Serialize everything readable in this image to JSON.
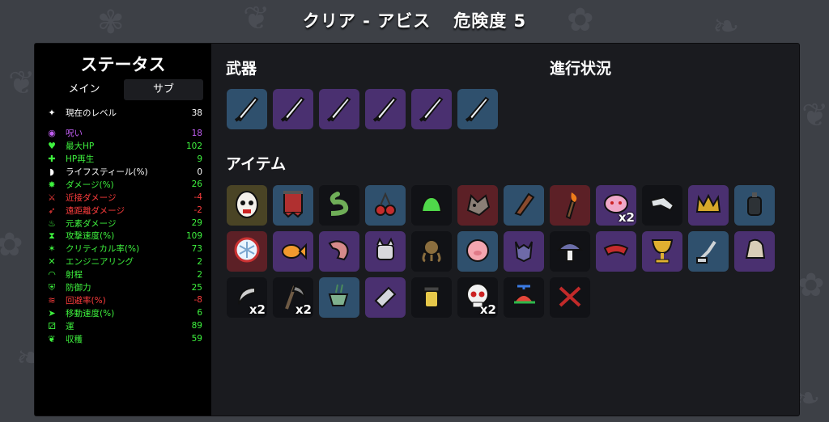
{
  "screen": {
    "title_left": "クリア - アビス",
    "title_right": "危険度 5"
  },
  "stats_panel": {
    "title": "ステータス",
    "tabs": [
      "メイン",
      "サブ"
    ],
    "active_tab": "サブ",
    "rows": [
      {
        "label": "現在のレベル",
        "value": "38",
        "color": "#ffffff",
        "icon": "level-icon"
      },
      {
        "label": "呪い",
        "value": "18",
        "color": "#c05ef2",
        "icon": "curse-icon"
      },
      {
        "label": "最大HP",
        "value": "102",
        "color": "#3ef23e",
        "icon": "heart-icon"
      },
      {
        "label": "HP再生",
        "value": "9",
        "color": "#3ef23e",
        "icon": "hp-regen-icon"
      },
      {
        "label": "ライフスティール(%)",
        "value": "0",
        "color": "#ffffff",
        "icon": "lifesteal-icon"
      },
      {
        "label": "ダメージ(%)",
        "value": "26",
        "color": "#3ef23e",
        "icon": "damage-icon"
      },
      {
        "label": "近接ダメージ",
        "value": "-4",
        "color": "#ff3d3d",
        "icon": "melee-icon"
      },
      {
        "label": "遠距離ダメージ",
        "value": "-2",
        "color": "#ff3d3d",
        "icon": "ranged-icon"
      },
      {
        "label": "元素ダメージ",
        "value": "29",
        "color": "#3ef23e",
        "icon": "elemental-icon"
      },
      {
        "label": "攻撃速度(%)",
        "value": "109",
        "color": "#3ef23e",
        "icon": "attack-speed-icon"
      },
      {
        "label": "クリティカル率(%)",
        "value": "73",
        "color": "#3ef23e",
        "icon": "crit-icon"
      },
      {
        "label": "エンジニアリング",
        "value": "2",
        "color": "#3ef23e",
        "icon": "engineering-icon"
      },
      {
        "label": "射程",
        "value": "2",
        "color": "#3ef23e",
        "icon": "range-icon"
      },
      {
        "label": "防御力",
        "value": "25",
        "color": "#3ef23e",
        "icon": "armor-icon"
      },
      {
        "label": "回避率(%)",
        "value": "-8",
        "color": "#ff3d3d",
        "icon": "dodge-icon"
      },
      {
        "label": "移動速度(%)",
        "value": "6",
        "color": "#3ef23e",
        "icon": "speed-icon"
      },
      {
        "label": "運",
        "value": "89",
        "color": "#3ef23e",
        "icon": "luck-icon"
      },
      {
        "label": "収穫",
        "value": "59",
        "color": "#3ef23e",
        "icon": "harvest-icon"
      }
    ]
  },
  "weapons": {
    "title": "武器",
    "slots": [
      {
        "icon": "blade-weapon-icon",
        "tier": 1
      },
      {
        "icon": "blade-weapon-icon",
        "tier": 2
      },
      {
        "icon": "blade-weapon-icon",
        "tier": 2
      },
      {
        "icon": "blade-weapon-icon",
        "tier": 2
      },
      {
        "icon": "blade-weapon-icon",
        "tier": 2
      },
      {
        "icon": "blade-weapon-icon",
        "tier": 1
      }
    ]
  },
  "progress": {
    "title": "進行状況"
  },
  "items": {
    "title": "アイテム",
    "slots": [
      {
        "icon": "egg-face-icon",
        "tier": 4,
        "qty": ""
      },
      {
        "icon": "banner-icon",
        "tier": 1,
        "qty": ""
      },
      {
        "icon": "snake-icon",
        "tier": 0,
        "qty": ""
      },
      {
        "icon": "cherry-bomb-icon",
        "tier": 1,
        "qty": ""
      },
      {
        "icon": "slime-icon",
        "tier": 0,
        "qty": ""
      },
      {
        "icon": "wolf-head-icon",
        "tier": 3,
        "qty": ""
      },
      {
        "icon": "plank-icon",
        "tier": 1,
        "qty": ""
      },
      {
        "icon": "torch-icon",
        "tier": 3,
        "qty": ""
      },
      {
        "icon": "pink-blob-icon",
        "tier": 2,
        "qty": "x2"
      },
      {
        "icon": "robot-arm-icon",
        "tier": 0,
        "qty": ""
      },
      {
        "icon": "crown-icon",
        "tier": 2,
        "qty": ""
      },
      {
        "icon": "canister-icon",
        "tier": 1,
        "qty": ""
      },
      {
        "icon": "snowflake-orb-icon",
        "tier": 3,
        "qty": ""
      },
      {
        "icon": "goldfish-icon",
        "tier": 2,
        "qty": ""
      },
      {
        "icon": "flesh-arm-icon",
        "tier": 2,
        "qty": ""
      },
      {
        "icon": "cat-robot-icon",
        "tier": 2,
        "qty": ""
      },
      {
        "icon": "octopus-icon",
        "tier": 0,
        "qty": ""
      },
      {
        "icon": "pig-icon",
        "tier": 1,
        "qty": ""
      },
      {
        "icon": "demon-mask-icon",
        "tier": 2,
        "qty": ""
      },
      {
        "icon": "mushroom-icon",
        "tier": 0,
        "qty": ""
      },
      {
        "icon": "red-scarf-icon",
        "tier": 2,
        "qty": ""
      },
      {
        "icon": "golden-chalice-icon",
        "tier": 2,
        "qty": ""
      },
      {
        "icon": "robot-lamp-icon",
        "tier": 1,
        "qty": ""
      },
      {
        "icon": "cloth-sack-icon",
        "tier": 2,
        "qty": ""
      },
      {
        "icon": "claw-icon",
        "tier": 0,
        "qty": "x2"
      },
      {
        "icon": "scythe-icon",
        "tier": 0,
        "qty": "x2"
      },
      {
        "icon": "tea-cup-icon",
        "tier": 1,
        "qty": ""
      },
      {
        "icon": "eraser-icon",
        "tier": 2,
        "qty": ""
      },
      {
        "icon": "honey-jar-icon",
        "tier": 0,
        "qty": ""
      },
      {
        "icon": "skull-icon",
        "tier": 0,
        "qty": "x2"
      },
      {
        "icon": "propeller-cap-icon",
        "tier": 0,
        "qty": ""
      },
      {
        "icon": "crossed-branch-icon",
        "tier": 0,
        "qty": ""
      }
    ]
  },
  "colors": {
    "tier0": "#111216",
    "tier1": "#2f506d",
    "tier2": "#4a3070",
    "tier3": "#5c2026",
    "tier4": "#4a4425"
  }
}
